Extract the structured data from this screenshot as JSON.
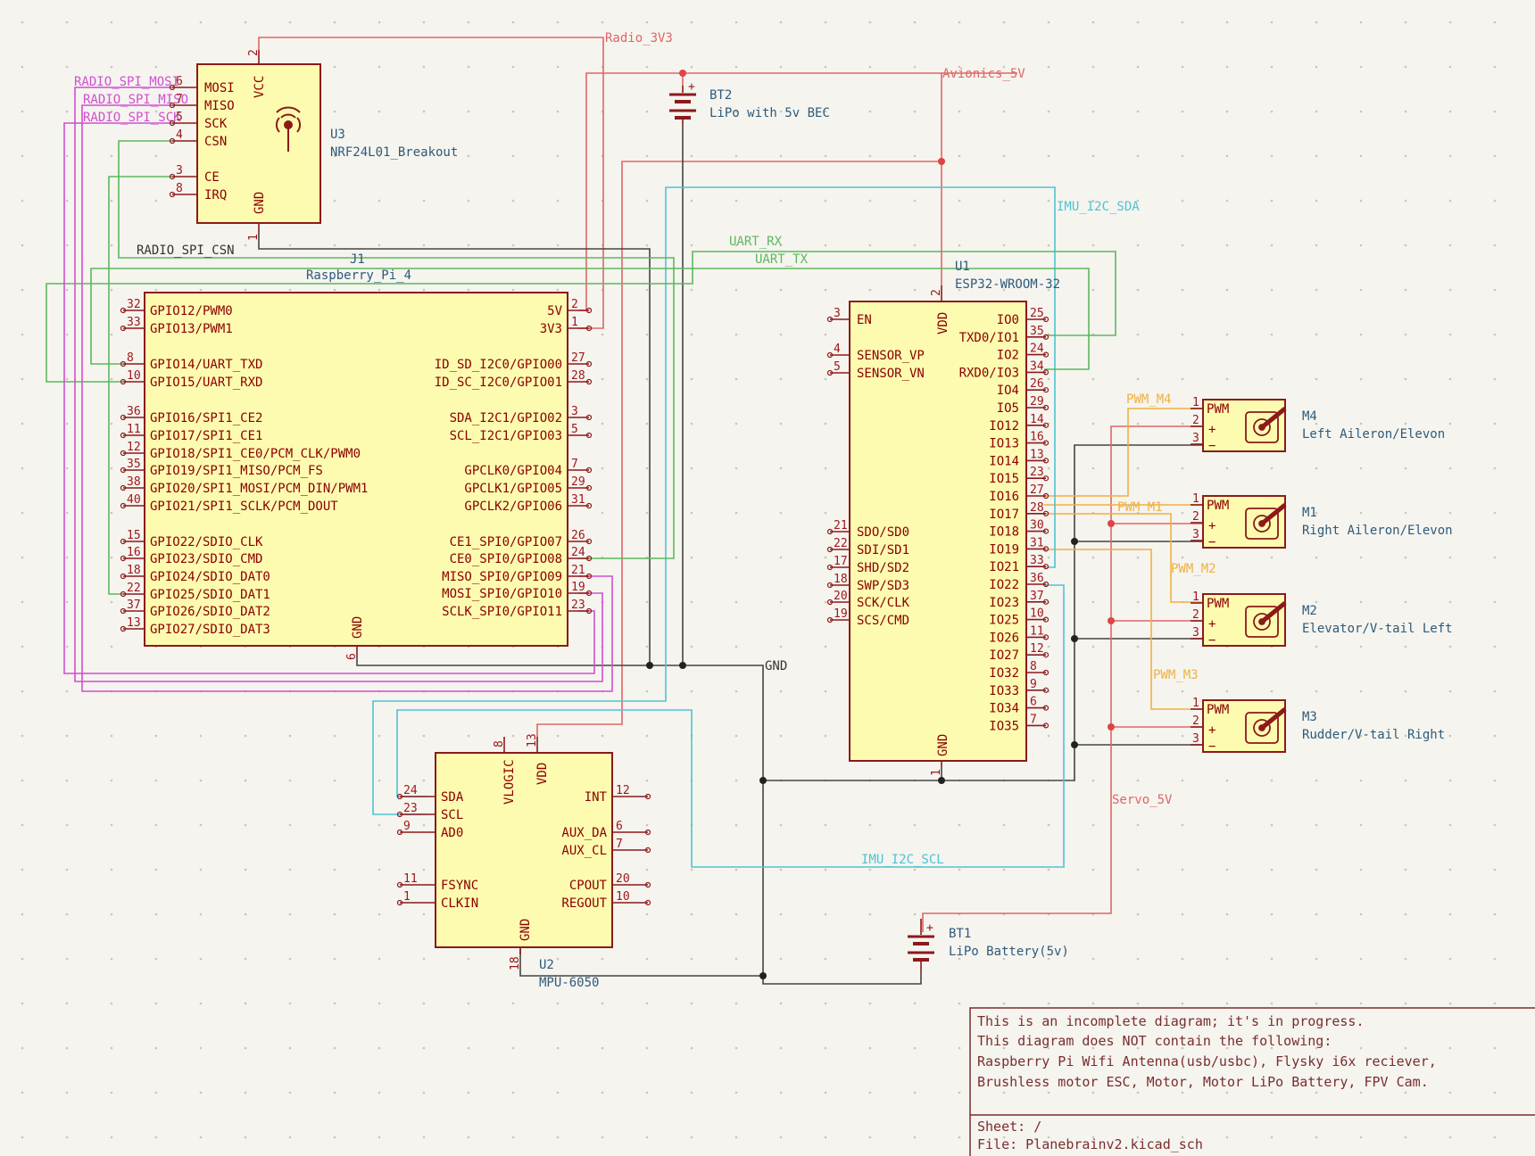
{
  "colors": {
    "background": "#f5f4ef",
    "power_wire": "#e06666",
    "ground_wire": "#444444",
    "i2c_wire": "#4fc3d0",
    "uart_wire": "#5cb85c",
    "spi_wire": "#d04fd0",
    "pwm_wire": "#f0b040",
    "component_fill": "#fdfbb0",
    "component_outline": "#8b1a1a"
  },
  "nets": {
    "radio_3v3": "Radio_3V3",
    "avionics_5v": "Avionics_5V",
    "imu_sda": "IMU_I2C_SDA",
    "imu_scl": "IMU_I2C_SCL",
    "uart_rx": "UART_RX",
    "uart_tx": "UART_TX",
    "radio_mosi": "RADIO_SPI_MOSI",
    "radio_miso": "RADIO_SPI_MISO",
    "radio_sck": "RADIO_SPI_SCK",
    "radio_csn": "RADIO_SPI_CSN",
    "gnd": "GND",
    "servo_5v": "Servo_5V",
    "pwm_m1": "PWM_M1",
    "pwm_m2": "PWM_M2",
    "pwm_m3": "PWM_M3",
    "pwm_m4": "PWM_M4"
  },
  "u3": {
    "ref": "U3",
    "value": "NRF24L01_Breakout",
    "vcc": "VCC",
    "gnd": "GND",
    "left_pins": [
      {
        "num": "6",
        "name": "MOSI"
      },
      {
        "num": "7",
        "name": "MISO"
      },
      {
        "num": "5",
        "name": "SCK"
      },
      {
        "num": "4",
        "name": "CSN"
      },
      {
        "num": "3",
        "name": "CE"
      },
      {
        "num": "8",
        "name": "IRQ"
      }
    ],
    "top_num": "2",
    "bottom_num": "1"
  },
  "bt2": {
    "ref": "BT2",
    "value": "LiPo with 5v BEC"
  },
  "bt1": {
    "ref": "BT1",
    "value": "LiPo Battery(5v)"
  },
  "j1": {
    "ref": "J1",
    "value": "Raspberry_Pi_4",
    "gnd": "GND",
    "gnd_num": "6",
    "left_pins": [
      {
        "num": "32",
        "name": "GPIO12/PWM0"
      },
      {
        "num": "33",
        "name": "GPIO13/PWM1"
      },
      {
        "num": "8",
        "name": "GPIO14/UART_TXD"
      },
      {
        "num": "10",
        "name": "GPIO15/UART_RXD"
      },
      {
        "num": "36",
        "name": "GPIO16/SPI1_CE2"
      },
      {
        "num": "11",
        "name": "GPIO17/SPI1_CE1"
      },
      {
        "num": "12",
        "name": "GPIO18/SPI1_CE0/PCM_CLK/PWM0"
      },
      {
        "num": "35",
        "name": "GPIO19/SPI1_MISO/PCM_FS"
      },
      {
        "num": "38",
        "name": "GPIO20/SPI1_MOSI/PCM_DIN/PWM1"
      },
      {
        "num": "40",
        "name": "GPIO21/SPI1_SCLK/PCM_DOUT"
      },
      {
        "num": "15",
        "name": "GPIO22/SDIO_CLK"
      },
      {
        "num": "16",
        "name": "GPIO23/SDIO_CMD"
      },
      {
        "num": "18",
        "name": "GPIO24/SDIO_DAT0"
      },
      {
        "num": "22",
        "name": "GPIO25/SDIO_DAT1"
      },
      {
        "num": "37",
        "name": "GPIO26/SDIO_DAT2"
      },
      {
        "num": "13",
        "name": "GPIO27/SDIO_DAT3"
      }
    ],
    "right_pins": [
      {
        "num": "2",
        "name": "5V"
      },
      {
        "num": "1",
        "name": "3V3"
      },
      {
        "num": "27",
        "name": "ID_SD_I2C0/GPIO00"
      },
      {
        "num": "28",
        "name": "ID_SC_I2C0/GPIO01"
      },
      {
        "num": "3",
        "name": "SDA_I2C1/GPIO02"
      },
      {
        "num": "5",
        "name": "SCL_I2C1/GPIO03"
      },
      {
        "num": "7",
        "name": "GPCLK0/GPIO04"
      },
      {
        "num": "29",
        "name": "GPCLK1/GPIO05"
      },
      {
        "num": "31",
        "name": "GPCLK2/GPIO06"
      },
      {
        "num": "26",
        "name": "CE1_SPI0/GPIO07"
      },
      {
        "num": "24",
        "name": "CE0_SPI0/GPIO08"
      },
      {
        "num": "21",
        "name": "MISO_SPI0/GPIO09"
      },
      {
        "num": "19",
        "name": "MOSI_SPI0/GPIO10"
      },
      {
        "num": "23",
        "name": "SCLK_SPI0/GPIO11"
      }
    ]
  },
  "u1": {
    "ref": "U1",
    "value": "ESP32-WROOM-32",
    "vdd": "VDD",
    "vdd_num": "2",
    "gnd": "GND",
    "gnd_num": "1",
    "left_pins": [
      {
        "num": "3",
        "name": "EN"
      },
      {
        "num": "4",
        "name": "SENSOR_VP"
      },
      {
        "num": "5",
        "name": "SENSOR_VN"
      },
      {
        "num": "21",
        "name": "SDO/SD0"
      },
      {
        "num": "22",
        "name": "SDI/SD1"
      },
      {
        "num": "17",
        "name": "SHD/SD2"
      },
      {
        "num": "18",
        "name": "SWP/SD3"
      },
      {
        "num": "20",
        "name": "SCK/CLK"
      },
      {
        "num": "19",
        "name": "SCS/CMD"
      }
    ],
    "right_pins": [
      {
        "num": "25",
        "name": "IO0"
      },
      {
        "num": "35",
        "name": "TXD0/IO1"
      },
      {
        "num": "24",
        "name": "IO2"
      },
      {
        "num": "34",
        "name": "RXD0/IO3"
      },
      {
        "num": "26",
        "name": "IO4"
      },
      {
        "num": "29",
        "name": "IO5"
      },
      {
        "num": "14",
        "name": "IO12"
      },
      {
        "num": "16",
        "name": "IO13"
      },
      {
        "num": "13",
        "name": "IO14"
      },
      {
        "num": "23",
        "name": "IO15"
      },
      {
        "num": "27",
        "name": "IO16"
      },
      {
        "num": "28",
        "name": "IO17"
      },
      {
        "num": "30",
        "name": "IO18"
      },
      {
        "num": "31",
        "name": "IO19"
      },
      {
        "num": "33",
        "name": "IO21"
      },
      {
        "num": "36",
        "name": "IO22"
      },
      {
        "num": "37",
        "name": "IO23"
      },
      {
        "num": "10",
        "name": "IO25"
      },
      {
        "num": "11",
        "name": "IO26"
      },
      {
        "num": "12",
        "name": "IO27"
      },
      {
        "num": "8",
        "name": "IO32"
      },
      {
        "num": "9",
        "name": "IO33"
      },
      {
        "num": "6",
        "name": "IO34"
      },
      {
        "num": "7",
        "name": "IO35"
      }
    ]
  },
  "u2": {
    "ref": "U2",
    "value": "MPU-6050",
    "vlogic": "VLOGIC",
    "vlogic_num": "8",
    "vdd": "VDD",
    "vdd_num": "13",
    "gnd": "GND",
    "gnd_num": "18",
    "left_pins": [
      {
        "num": "24",
        "name": "SDA"
      },
      {
        "num": "23",
        "name": "SCL"
      },
      {
        "num": "9",
        "name": "AD0"
      },
      {
        "num": "11",
        "name": "FSYNC"
      },
      {
        "num": "1",
        "name": "CLKIN"
      }
    ],
    "right_pins": [
      {
        "num": "12",
        "name": "INT"
      },
      {
        "num": "6",
        "name": "AUX_DA"
      },
      {
        "num": "7",
        "name": "AUX_CL"
      },
      {
        "num": "20",
        "name": "CPOUT"
      },
      {
        "num": "10",
        "name": "REGOUT"
      }
    ]
  },
  "servos": [
    {
      "ref": "M4",
      "desc": "Left Aileron/Elevon",
      "label": "PWM",
      "plus": "+",
      "minus": "−"
    },
    {
      "ref": "M1",
      "desc": "Right Aileron/Elevon",
      "label": "PWM",
      "plus": "+",
      "minus": "−"
    },
    {
      "ref": "M2",
      "desc": "Elevator/V-tail Left",
      "label": "PWM",
      "plus": "+",
      "minus": "−"
    },
    {
      "ref": "M3",
      "desc": "Rudder/V-tail Right",
      "label": "PWM",
      "plus": "+",
      "minus": "−"
    }
  ],
  "servo_pin_nums": [
    "1",
    "2",
    "3"
  ],
  "notes": {
    "lines": [
      "This is an incomplete diagram; it's in progress.",
      "This diagram does NOT contain the following:",
      "Raspberry Pi Wifi Antenna(usb/usbc), Flysky i6x reciever,",
      "Brushless motor ESC, Motor, Motor LiPo Battery, FPV Cam."
    ],
    "sheet": "Sheet: /",
    "file": "File: Planebrainv2.kicad_sch"
  }
}
